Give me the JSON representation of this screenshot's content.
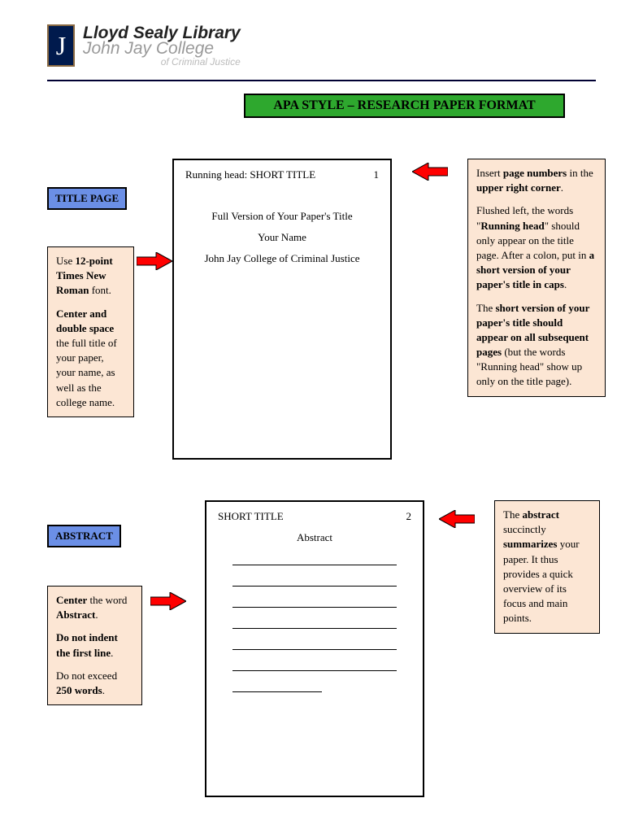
{
  "header": {
    "logo_letter": "J",
    "line1": "Lloyd Sealy Library",
    "line2": "John Jay College",
    "line3": "of Criminal Justice"
  },
  "banner": "APA STYLE – RESEARCH PAPER FORMAT",
  "labels": {
    "title_page": "TITLE PAGE",
    "abstract": "ABSTRACT"
  },
  "box_font": {
    "p1_a": "Use ",
    "p1_b": "12-point Times New Roman",
    "p1_c": " font.",
    "p2_a": "Center and double space",
    "p2_b": " the full title of your paper, your name, as well as the college name."
  },
  "box_pagenum": {
    "p1_a": "Insert ",
    "p1_b": "page numbers",
    "p1_c": " in the ",
    "p1_d": "upper right corner",
    "p1_e": ".",
    "p2_a": "Flushed left, the words \"",
    "p2_b": "Running head",
    "p2_c": "\" should only appear on the title page. After a colon, put in ",
    "p2_d": "a short version of your paper's title in caps",
    "p2_e": ".",
    "p3_a": "The ",
    "p3_b": "short version of your paper's title should appear on all subsequent pages",
    "p3_c": " (but the words \"Running head\" show up only on the title page)."
  },
  "box_abs_left": {
    "p1_a": "Center",
    "p1_b": " the word ",
    "p1_c": "Abstract",
    "p1_d": ".",
    "p2_a": "Do not indent the first line",
    "p2_b": ".",
    "p3_a": "Do not exceed ",
    "p3_b": "250 words",
    "p3_c": "."
  },
  "box_abs_right": {
    "p1_a": "The ",
    "p1_b": "abstract",
    "p1_c": " succinctly ",
    "p1_d": "summarizes",
    "p1_e": " your paper. It thus provides a quick overview of its focus and main points."
  },
  "paper1": {
    "running_head": "Running head: SHORT TITLE",
    "page": "1",
    "title": "Full Version of Your Paper's Title",
    "author": "Your Name",
    "institution": "John Jay College of Criminal Justice"
  },
  "paper2": {
    "short_title": "SHORT TITLE",
    "page": "2",
    "heading": "Abstract"
  }
}
